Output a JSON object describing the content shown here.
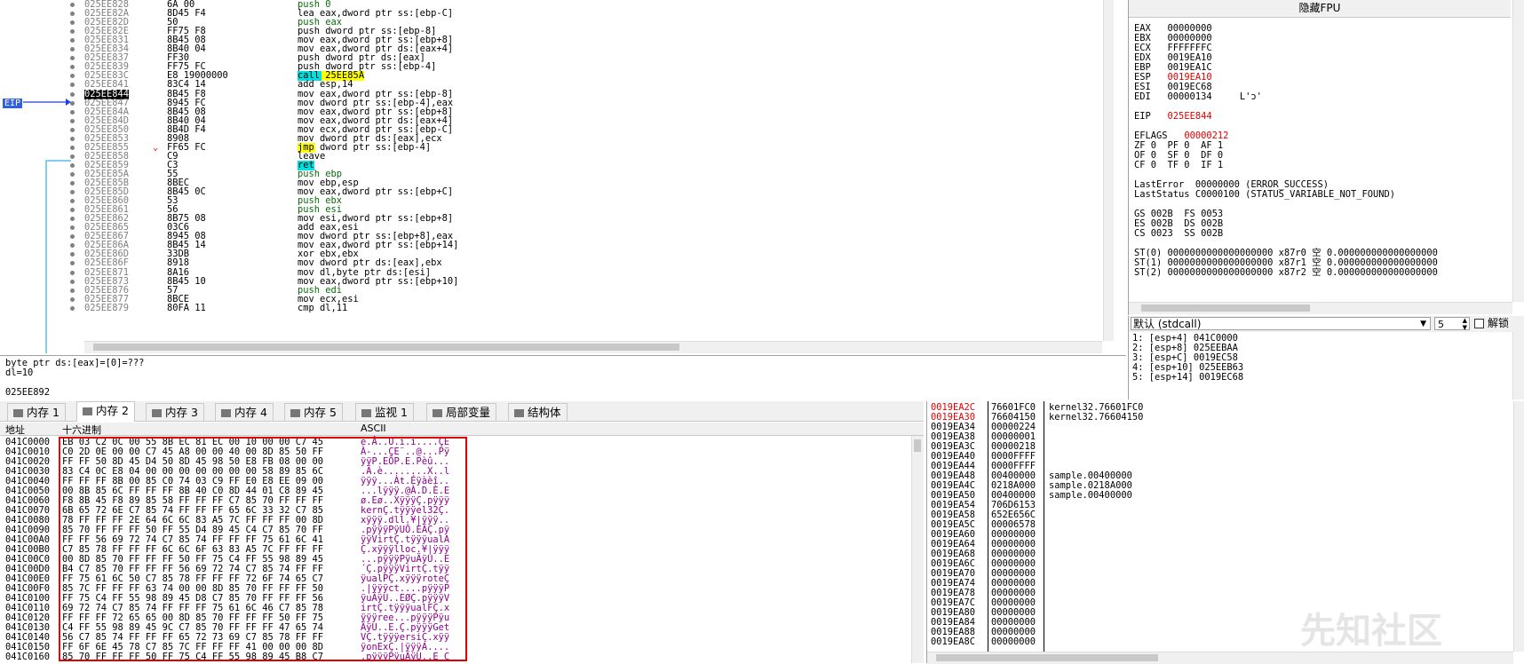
{
  "disasm": {
    "eip_label": "EIP",
    "rows": [
      {
        "addr": "025EE828",
        "bytes": "6A 00",
        "ins": "push 0"
      },
      {
        "addr": "025EE82A",
        "bytes": "8D45 F4",
        "ins": "lea eax,dword ptr ss:[ebp-C]"
      },
      {
        "addr": "025EE82D",
        "bytes": "50",
        "ins": "push eax"
      },
      {
        "addr": "025EE82E",
        "bytes": "FF75 F8",
        "ins": "push dword ptr ss:[ebp-8]"
      },
      {
        "addr": "025EE831",
        "bytes": "8B45 08",
        "ins": "mov eax,dword ptr ss:[ebp+8]"
      },
      {
        "addr": "025EE834",
        "bytes": "8B40 04",
        "ins": "mov eax,dword ptr ds:[eax+4]"
      },
      {
        "addr": "025EE837",
        "bytes": "FF30",
        "ins": "push dword ptr ds:[eax]"
      },
      {
        "addr": "025EE839",
        "bytes": "FF75 FC",
        "ins": "push dword ptr ss:[ebp-4]"
      },
      {
        "addr": "025EE83C",
        "bytes": "E8 19000000",
        "ins": "call 25EE85A"
      },
      {
        "addr": "025EE841",
        "bytes": "83C4 14",
        "ins": "add esp,14"
      },
      {
        "addr": "025EE844",
        "bytes": "8B45 F8",
        "ins": "mov eax,dword ptr ss:[ebp-8]"
      },
      {
        "addr": "025EE847",
        "bytes": "8945 FC",
        "ins": "mov dword ptr ss:[ebp-4],eax"
      },
      {
        "addr": "025EE84A",
        "bytes": "8B45 08",
        "ins": "mov eax,dword ptr ss:[ebp+8]"
      },
      {
        "addr": "025EE84D",
        "bytes": "8B40 04",
        "ins": "mov eax,dword ptr ds:[eax+4]"
      },
      {
        "addr": "025EE850",
        "bytes": "8B4D F4",
        "ins": "mov ecx,dword ptr ss:[ebp-C]"
      },
      {
        "addr": "025EE853",
        "bytes": "8908",
        "ins": "mov dword ptr ds:[eax],ecx"
      },
      {
        "addr": "025EE855",
        "bytes": "FF65 FC",
        "ins": "jmp dword ptr ss:[ebp-4]"
      },
      {
        "addr": "025EE858",
        "bytes": "C9",
        "ins": "leave"
      },
      {
        "addr": "025EE859",
        "bytes": "C3",
        "ins": "ret"
      },
      {
        "addr": "025EE85A",
        "bytes": "55",
        "ins": "push ebp"
      },
      {
        "addr": "025EE85B",
        "bytes": "8BEC",
        "ins": "mov ebp,esp"
      },
      {
        "addr": "025EE85D",
        "bytes": "8B45 0C",
        "ins": "mov eax,dword ptr ss:[ebp+C]"
      },
      {
        "addr": "025EE860",
        "bytes": "53",
        "ins": "push ebx"
      },
      {
        "addr": "025EE861",
        "bytes": "56",
        "ins": "push esi"
      },
      {
        "addr": "025EE862",
        "bytes": "8B75 08",
        "ins": "mov esi,dword ptr ss:[ebp+8]"
      },
      {
        "addr": "025EE865",
        "bytes": "03C6",
        "ins": "add eax,esi"
      },
      {
        "addr": "025EE867",
        "bytes": "8945 08",
        "ins": "mov dword ptr ss:[ebp+8],eax"
      },
      {
        "addr": "025EE86A",
        "bytes": "8B45 14",
        "ins": "mov eax,dword ptr ss:[ebp+14]"
      },
      {
        "addr": "025EE86D",
        "bytes": "33DB",
        "ins": "xor ebx,ebx"
      },
      {
        "addr": "025EE86F",
        "bytes": "8918",
        "ins": "mov dword ptr ds:[eax],ebx"
      },
      {
        "addr": "025EE871",
        "bytes": "8A16",
        "ins": "mov dl,byte ptr ds:[esi]"
      },
      {
        "addr": "025EE873",
        "bytes": "8B45 10",
        "ins": "mov eax,dword ptr ss:[ebp+10]"
      },
      {
        "addr": "025EE876",
        "bytes": "57",
        "ins": "push edi"
      },
      {
        "addr": "025EE877",
        "bytes": "8BCE",
        "ins": "mov ecx,esi"
      },
      {
        "addr": "025EE879",
        "bytes": "80FA 11",
        "ins": "cmp dl,11"
      }
    ]
  },
  "info": {
    "line1": "byte ptr ds:[eax]=[0]=???",
    "line2": "dl=10",
    "line3": "025EE892"
  },
  "tabs": [
    {
      "label": "内存 1"
    },
    {
      "label": "内存 2"
    },
    {
      "label": "内存 3"
    },
    {
      "label": "内存 4"
    },
    {
      "label": "内存 5"
    },
    {
      "label": "监视 1"
    },
    {
      "label": "局部变量"
    },
    {
      "label": "结构体"
    }
  ],
  "dump": {
    "col_addr": "地址",
    "col_hex": "十六进制",
    "col_ascii": "ASCII",
    "rows": [
      {
        "a": "041C0000",
        "h": "EB 03 C2 0C 00 55 8B EC 81 EC 00 10 00 00 C7 45",
        "s": "ë.Â..U.ì.ì....ÇE"
      },
      {
        "a": "041C0010",
        "h": "C0 2D 0E 00 00 C7 45 A8 00 00 40 00 8D 85 50 FF",
        "s": "À-...ÇE¨..@...Pÿ"
      },
      {
        "a": "041C0020",
        "h": "FF FF 50 8D 45 D4 50 8D 45 98 50 E8 FB 08 00 00",
        "s": "ÿÿP.EÔP.E.Pèû..."
      },
      {
        "a": "041C0030",
        "h": "83 C4 0C E8 04 00 00 00 00 00 00 00 58 89 85 6C",
        "s": ".Ä.è........X..l"
      },
      {
        "a": "041C0040",
        "h": "FF FF FF 8B 00 85 C0 74 03 C9 FF E0 E8 EE 09 00",
        "s": "ÿÿÿ...Àt.Éÿàèî.."
      },
      {
        "a": "041C0050",
        "h": "00 8B 85 6C FF FF FF 8B 40 C0 8D 44 01 C8 89 45",
        "s": "...lÿÿÿ.@À.D.È.E"
      },
      {
        "a": "041C0060",
        "h": "F8 8B 45 F8 89 85 58 FF FF FF C7 85 70 FF FF FF",
        "s": "ø.Eø..XÿÿÿÇ.pÿÿÿ"
      },
      {
        "a": "041C0070",
        "h": "6B 65 72 6E C7 85 74 FF FF FF 65 6C 33 32 C7 85",
        "s": "kernÇ.tÿÿÿel32Ç."
      },
      {
        "a": "041C0080",
        "h": "78 FF FF FF 2E 64 6C 6C 83 A5 7C FF FF FF 00 8D",
        "s": "xÿÿÿ.dll.¥|ÿÿÿ.."
      },
      {
        "a": "041C0090",
        "h": "85 70 FF FF FF 50 FF 55 D4 89 45 C4 C7 85 70 FF",
        "s": ".pÿÿÿPÿUÔ.EÄÇ.pÿ"
      },
      {
        "a": "041C00A0",
        "h": "FF FF 56 69 72 74 C7 85 74 FF FF FF 75 61 6C 41",
        "s": "ÿÿVirtÇ.tÿÿÿualA"
      },
      {
        "a": "041C00B0",
        "h": "C7 85 78 FF FF FF 6C 6C 6F 63 83 A5 7C FF FF FF",
        "s": "Ç.xÿÿÿlloc.¥|ÿÿÿ"
      },
      {
        "a": "041C00C0",
        "h": "00 8D 85 70 FF FF FF 50 FF 75 C4 FF 55 98 89 45",
        "s": "...pÿÿÿPÿuÄÿU..E"
      },
      {
        "a": "041C00D0",
        "h": "B4 C7 85 70 FF FF FF 56 69 72 74 C7 85 74 FF FF",
        "s": "´Ç.pÿÿÿVirtÇ.tÿÿ"
      },
      {
        "a": "041C00E0",
        "h": "FF 75 61 6C 50 C7 85 78 FF FF FF 72 6F 74 65 C7",
        "s": "ÿualPÇ.xÿÿÿroteÇ"
      },
      {
        "a": "041C00F0",
        "h": "85 7C FF FF FF 63 74 00 00 8D 85 70 FF FF FF 50",
        "s": ".|ÿÿÿct....pÿÿÿP"
      },
      {
        "a": "041C0100",
        "h": "FF 75 C4 FF 55 98 89 45 D8 C7 85 70 FF FF FF 56",
        "s": "ÿuÄÿU..EØÇ.pÿÿÿV"
      },
      {
        "a": "041C0110",
        "h": "69 72 74 C7 85 74 FF FF FF 75 61 6C 46 C7 85 78",
        "s": "irtÇ.tÿÿÿualFÇ.x"
      },
      {
        "a": "041C0120",
        "h": "FF FF FF 72 65 65 00 8D 85 70 FF FF FF 50 FF 75",
        "s": "ÿÿÿree...pÿÿÿPÿu"
      },
      {
        "a": "041C0130",
        "h": "C4 FF 55 98 89 45 9C C7 85 70 FF FF FF 47 65 74",
        "s": "ÄÿU..E.Ç.pÿÿÿGet"
      },
      {
        "a": "041C0140",
        "h": "56 C7 85 74 FF FF FF 65 72 73 69 C7 85 78 FF FF",
        "s": "VÇ.tÿÿÿersiÇ.xÿÿ"
      },
      {
        "a": "041C0150",
        "h": "FF 6F 6E 45 78 C7 85 7C FF FF FF 41 00 00 00 8D",
        "s": "ÿonExÇ.|ÿÿÿA...."
      },
      {
        "a": "041C0160",
        "h": "85 70 FF FF FF 50 FF 75 C4 FF 55 98 89 45 B8 C7",
        "s": ".pÿÿÿPÿuÄÿU..E¸Ç"
      }
    ]
  },
  "regs": {
    "title": "隐藏FPU",
    "lines": [
      {
        "t": "EAX   00000000",
        "red": false
      },
      {
        "t": "EBX   00000000",
        "red": false
      },
      {
        "t": "ECX   FFFFFFFC",
        "red": false
      },
      {
        "t": "EDX   0019EA10",
        "red": false
      },
      {
        "t": "EBP   0019EA1C",
        "red": false
      },
      {
        "t": "ESP   0019EA10",
        "red": true
      },
      {
        "t": "ESI   0019EC68",
        "red": false
      },
      {
        "t": "EDI   00000134     L'ɔ'",
        "red": false
      },
      {
        "t": "",
        "red": false
      },
      {
        "t": "EIP   025EE844",
        "red": true
      },
      {
        "t": "",
        "red": false
      },
      {
        "t": "EFLAGS   00000212",
        "red": true
      },
      {
        "t": "ZF 0  PF 0  AF 1",
        "red": false
      },
      {
        "t": "OF 0  SF 0  DF 0",
        "red": false
      },
      {
        "t": "CF 0  TF 0  IF 1",
        "red": false
      },
      {
        "t": "",
        "red": false
      },
      {
        "t": "LastError  00000000 (ERROR_SUCCESS)",
        "red": false
      },
      {
        "t": "LastStatus C0000100 (STATUS_VARIABLE_NOT_FOUND)",
        "red": false
      },
      {
        "t": "",
        "red": false
      },
      {
        "t": "GS 002B  FS 0053",
        "red": false
      },
      {
        "t": "ES 002B  DS 002B",
        "red": false
      },
      {
        "t": "CS 0023  SS 002B",
        "red": false
      },
      {
        "t": "",
        "red": false
      },
      {
        "t": "ST(0) 0000000000000000000 x87r0 空 0.000000000000000000",
        "red": false
      },
      {
        "t": "ST(1) 0000000000000000000 x87r1 空 0.000000000000000000",
        "red": false
      },
      {
        "t": "ST(2) 0000000000000000000 x87r2 空 0.000000000000000000",
        "red": false
      }
    ]
  },
  "callconv": {
    "selected": "默认 (stdcall)",
    "count": "5",
    "unlock": "解锁"
  },
  "args": [
    "1: [esp+4] 041C0000",
    "2: [esp+8] 025EEBAA",
    "3: [esp+C] 0019EC58",
    "4: [esp+10] 025EEB63",
    "5: [esp+14] 0019EC68"
  ],
  "stack": [
    {
      "a": "0019EA2C",
      "v": "76601FC0",
      "c": "kernel32.76601FC0",
      "red": true
    },
    {
      "a": "0019EA30",
      "v": "76604150",
      "c": "kernel32.76604150",
      "red": true
    },
    {
      "a": "0019EA34",
      "v": "00000224",
      "c": ""
    },
    {
      "a": "0019EA38",
      "v": "00000001",
      "c": ""
    },
    {
      "a": "0019EA3C",
      "v": "00000218",
      "c": ""
    },
    {
      "a": "0019EA40",
      "v": "0000FFFF",
      "c": ""
    },
    {
      "a": "0019EA44",
      "v": "0000FFFF",
      "c": ""
    },
    {
      "a": "0019EA48",
      "v": "00400000",
      "c": "sample.00400000"
    },
    {
      "a": "0019EA4C",
      "v": "0218A000",
      "c": "sample.0218A000"
    },
    {
      "a": "0019EA50",
      "v": "00400000",
      "c": "sample.00400000"
    },
    {
      "a": "0019EA54",
      "v": "706D6153",
      "c": ""
    },
    {
      "a": "0019EA58",
      "v": "652E656C",
      "c": ""
    },
    {
      "a": "0019EA5C",
      "v": "00006578",
      "c": ""
    },
    {
      "a": "0019EA60",
      "v": "00000000",
      "c": ""
    },
    {
      "a": "0019EA64",
      "v": "00000000",
      "c": ""
    },
    {
      "a": "0019EA68",
      "v": "00000000",
      "c": ""
    },
    {
      "a": "0019EA6C",
      "v": "00000000",
      "c": ""
    },
    {
      "a": "0019EA70",
      "v": "00000000",
      "c": ""
    },
    {
      "a": "0019EA74",
      "v": "00000000",
      "c": ""
    },
    {
      "a": "0019EA78",
      "v": "00000000",
      "c": ""
    },
    {
      "a": "0019EA7C",
      "v": "00000000",
      "c": ""
    },
    {
      "a": "0019EA80",
      "v": "00000000",
      "c": ""
    },
    {
      "a": "0019EA84",
      "v": "00000000",
      "c": ""
    },
    {
      "a": "0019EA88",
      "v": "00000000",
      "c": ""
    },
    {
      "a": "0019EA8C",
      "v": "00000000",
      "c": ""
    }
  ],
  "watermark": "先知社区"
}
